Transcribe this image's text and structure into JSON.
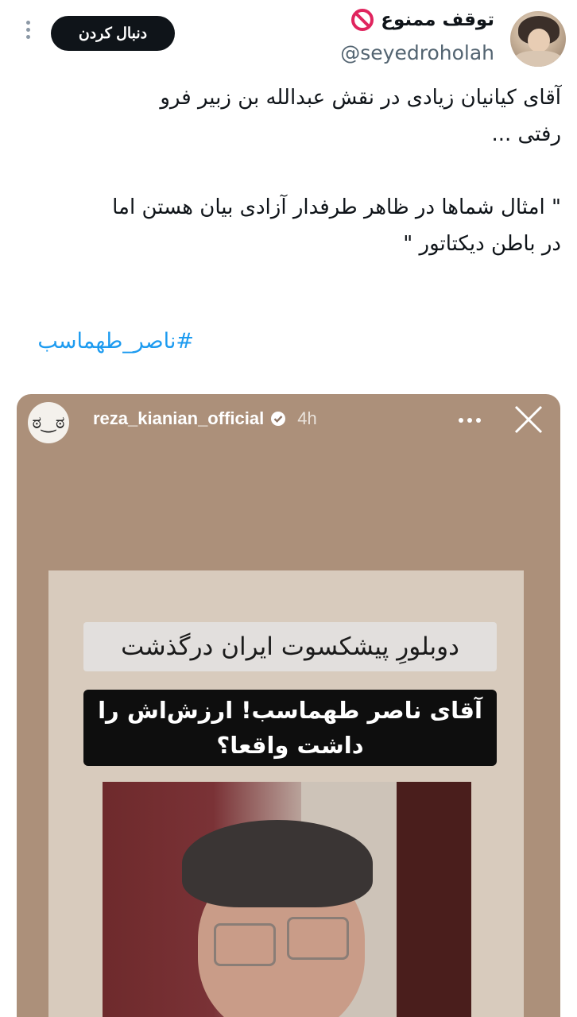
{
  "header": {
    "display_name": "توقف ممنوع",
    "status_icon": "no-entry-icon",
    "handle": "@seyedroholah",
    "follow_label": "دنبال کردن"
  },
  "tweet": {
    "text": "آقای کیانیان زیادی در نقش عبدالله بن زبیر فرو\nرفتی ...\n\n\" امثال شماها در ظاهر طرفدار آزادی بیان هستن اما\nدر باطن دیکتاتور \"",
    "hashtag": "#ناصر_طهماسب"
  },
  "media": {
    "story_username": "reza_kianian_official",
    "story_time": "4h",
    "caption_top": "دوبلورِ پیشکسوت ایران درگذشت",
    "caption_bottom": "آقای ناصر طهماسب! ارزش‌اش را\nداشت واقعا؟"
  },
  "colors": {
    "accent": "#1d9bf0",
    "text": "#0f1419",
    "muted": "#536471",
    "story_bg": "#ac907a"
  }
}
